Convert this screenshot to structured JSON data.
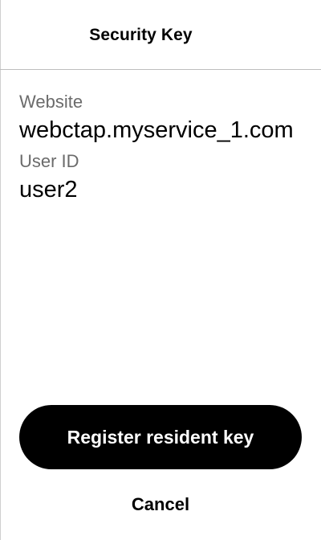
{
  "dialog": {
    "title": "Security Key"
  },
  "fields": {
    "website": {
      "label": "Website",
      "value": "webctap.myservice_1.com"
    },
    "user_id": {
      "label": "User ID",
      "value": "user2"
    }
  },
  "actions": {
    "register_label": "Register resident key",
    "cancel_label": "Cancel"
  }
}
